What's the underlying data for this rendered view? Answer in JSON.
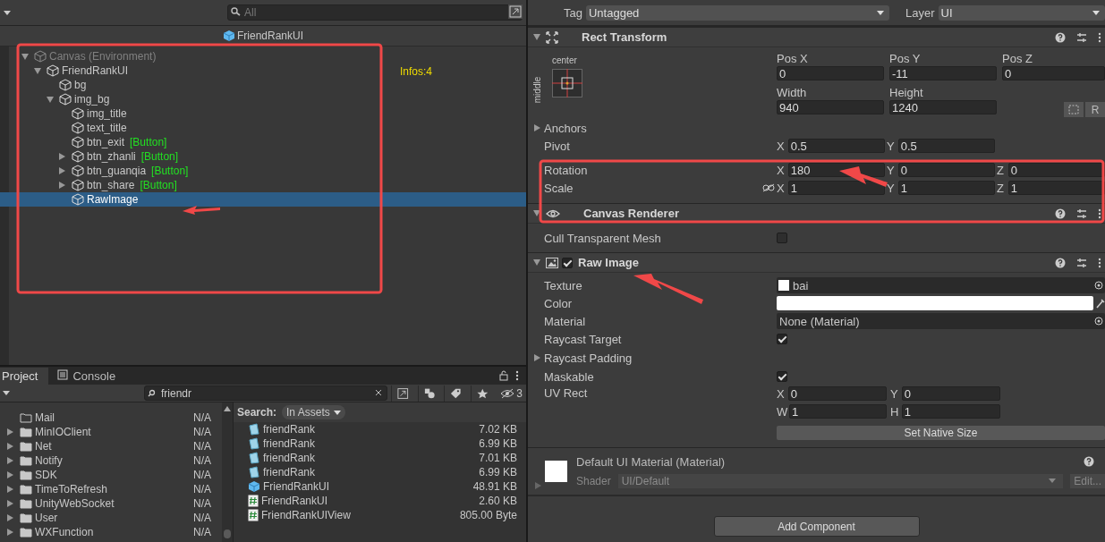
{
  "hierarchy": {
    "search": {
      "placeholder": "All"
    },
    "prefab_title": "FriendRankUI",
    "info": "Infos:4",
    "tree": [
      {
        "name": "Canvas (Environment)",
        "kind": "environment",
        "expanded": true,
        "selected": false,
        "children": [
          {
            "name": "FriendRankUI",
            "kind": "object",
            "expanded": true,
            "selected": false,
            "children": [
              {
                "name": "bg",
                "kind": "object",
                "selected": false
              },
              {
                "name": "img_bg",
                "kind": "object",
                "expanded": true,
                "selected": false,
                "children": [
                  {
                    "name": "img_title",
                    "kind": "object",
                    "selected": false
                  },
                  {
                    "name": "text_title",
                    "kind": "object",
                    "selected": false
                  },
                  {
                    "name": "btn_exit",
                    "kind": "object",
                    "tag": "[Button]",
                    "selected": false
                  },
                  {
                    "name": "btn_zhanli",
                    "kind": "object",
                    "tag": "[Button]",
                    "expanded": false,
                    "selected": false
                  },
                  {
                    "name": "btn_guanqia",
                    "kind": "object",
                    "tag": "[Button]",
                    "expanded": false,
                    "selected": false
                  },
                  {
                    "name": "btn_share",
                    "kind": "object",
                    "tag": "[Button]",
                    "expanded": false,
                    "selected": false
                  },
                  {
                    "name": "RawImage",
                    "kind": "object",
                    "selected": true
                  }
                ]
              }
            ]
          }
        ]
      }
    ]
  },
  "project": {
    "tabs": [
      {
        "label": "Project",
        "selected": true
      },
      {
        "label": "Console",
        "selected": false
      }
    ],
    "search": {
      "value": "friendr"
    },
    "hidden_count": "3",
    "folders": [
      {
        "name": "Mail",
        "size": "N/A",
        "expandable": false
      },
      {
        "name": "MinIOClient",
        "size": "N/A",
        "expandable": true
      },
      {
        "name": "Net",
        "size": "N/A",
        "expandable": true
      },
      {
        "name": "Notify",
        "size": "N/A",
        "expandable": true
      },
      {
        "name": "SDK",
        "size": "N/A",
        "expandable": true
      },
      {
        "name": "TimeToRefresh",
        "size": "N/A",
        "expandable": true
      },
      {
        "name": "UnityWebSocket",
        "size": "N/A",
        "expandable": true
      },
      {
        "name": "User",
        "size": "N/A",
        "expandable": true
      },
      {
        "name": "WXFunction",
        "size": "N/A",
        "expandable": true
      }
    ],
    "search_label": "Search:",
    "search_scope": "In Assets",
    "results": [
      {
        "name": "friendRank",
        "kind": "asset",
        "size": "7.02 KB"
      },
      {
        "name": "friendRank",
        "kind": "asset",
        "size": "6.99 KB"
      },
      {
        "name": "friendRank",
        "kind": "asset",
        "size": "7.01 KB"
      },
      {
        "name": "friendRank",
        "kind": "asset",
        "size": "6.99 KB"
      },
      {
        "name": "FriendRankUI",
        "kind": "prefab",
        "size": "48.91 KB"
      },
      {
        "name": "FriendRankUI",
        "kind": "script",
        "size": "2.60 KB"
      },
      {
        "name": "FriendRankUIView",
        "kind": "script",
        "size": "805.00 Byte"
      }
    ]
  },
  "inspector": {
    "tag": {
      "label": "Tag",
      "value": "Untagged"
    },
    "layer": {
      "label": "Layer",
      "value": "UI"
    },
    "rect_transform": {
      "title": "Rect Transform",
      "anchor_h": "center",
      "anchor_v": "middle",
      "position": [
        {
          "label": "Pos X",
          "value": "0"
        },
        {
          "label": "Pos Y",
          "value": "-11"
        },
        {
          "label": "Pos Z",
          "value": "0"
        }
      ],
      "size": [
        {
          "label": "Width",
          "value": "940"
        },
        {
          "label": "Height",
          "value": "1240"
        }
      ],
      "raw_button": "R",
      "rows": [
        {
          "label": "Anchors",
          "kind": "foldout",
          "expanded": false
        },
        {
          "label": "Pivot",
          "kind": "vector",
          "fields": [
            {
              "axis": "X",
              "value": "0.5"
            },
            {
              "axis": "Y",
              "value": "0.5"
            }
          ]
        },
        {
          "label": "Rotation",
          "kind": "vector",
          "fields": [
            {
              "axis": "X",
              "value": "180"
            },
            {
              "axis": "Y",
              "value": "0"
            },
            {
              "axis": "Z",
              "value": "0"
            }
          ]
        },
        {
          "label": "Scale",
          "kind": "vector",
          "unlinked": true,
          "fields": [
            {
              "axis": "X",
              "value": "1"
            },
            {
              "axis": "Y",
              "value": "1"
            },
            {
              "axis": "Z",
              "value": "1"
            }
          ]
        }
      ]
    },
    "canvas_renderer": {
      "title": "Canvas Renderer",
      "rows": [
        {
          "label": "Cull Transparent Mesh",
          "checked": false
        }
      ]
    },
    "raw_image": {
      "title": "Raw Image",
      "enabled": true,
      "rows": [
        {
          "label": "Texture",
          "kind": "object",
          "value": "bai"
        },
        {
          "label": "Color",
          "kind": "color",
          "color": "#ffffff"
        },
        {
          "label": "Material",
          "kind": "object",
          "value": "None (Material)"
        },
        {
          "label": "Raycast Target",
          "kind": "checkbox",
          "checked": true
        },
        {
          "label": "Raycast Padding",
          "kind": "foldout",
          "expanded": false
        },
        {
          "label": "Maskable",
          "kind": "checkbox",
          "checked": true
        },
        {
          "label": "UV Rect",
          "kind": "rect",
          "fields": [
            {
              "axis": "X",
              "value": "0"
            },
            {
              "axis": "Y",
              "value": "0"
            },
            {
              "axis": "W",
              "value": "1"
            },
            {
              "axis": "H",
              "value": "1"
            }
          ]
        }
      ],
      "button": "Set Native Size"
    },
    "material": {
      "title": "Default UI Material (Material)",
      "shader_label": "Shader",
      "shader": "UI/Default",
      "edit": "Edit..."
    },
    "add_component": "Add Component"
  }
}
